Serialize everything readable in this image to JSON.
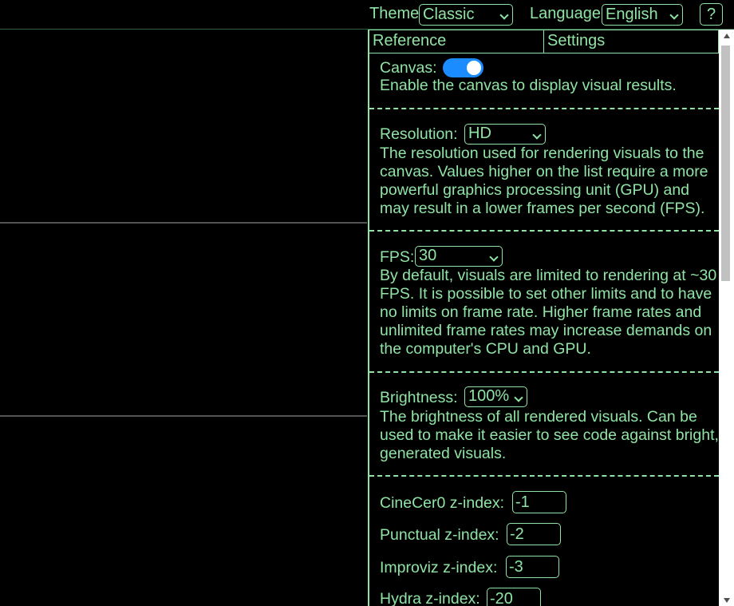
{
  "topbar": {
    "theme_label": "Theme",
    "theme_value": "Classic",
    "language_label": "Language",
    "language_value": "English",
    "help_label": "?"
  },
  "tabs": [
    {
      "label": "Reference"
    },
    {
      "label": "Settings"
    }
  ],
  "settings": {
    "canvas": {
      "label": "Canvas:",
      "enabled": true,
      "description": "Enable the canvas to display visual results."
    },
    "resolution": {
      "label": "Resolution:",
      "value": "HD",
      "description": "The resolution used for rendering visuals to the canvas. Values higher on the list require a more powerful graphics processing unit (GPU) and may result in a lower frames per second (FPS)."
    },
    "fps": {
      "label": "FPS:",
      "value": "30",
      "description": "By default, visuals are limited to rendering at ~30 FPS. It is possible to set other limits and to have no limits on frame rate. Higher frame rates and unlimited frame rates may increase demands on the computer's CPU and GPU."
    },
    "brightness": {
      "label": "Brightness:",
      "value": "100%",
      "description": "The brightness of all rendered visuals. Can be used to make it easier to see code against bright, generated visuals."
    },
    "zindex": [
      {
        "label": "CineCer0 z-index:",
        "value": "-1"
      },
      {
        "label": "Punctual z-index:",
        "value": "-2"
      },
      {
        "label": "Improviz z-index:",
        "value": "-3"
      },
      {
        "label": "Hydra z-index:",
        "value": "-20"
      }
    ]
  },
  "colors": {
    "text": "#8fe3a5",
    "background": "#000000",
    "toggle_on": "#1a8cff"
  }
}
